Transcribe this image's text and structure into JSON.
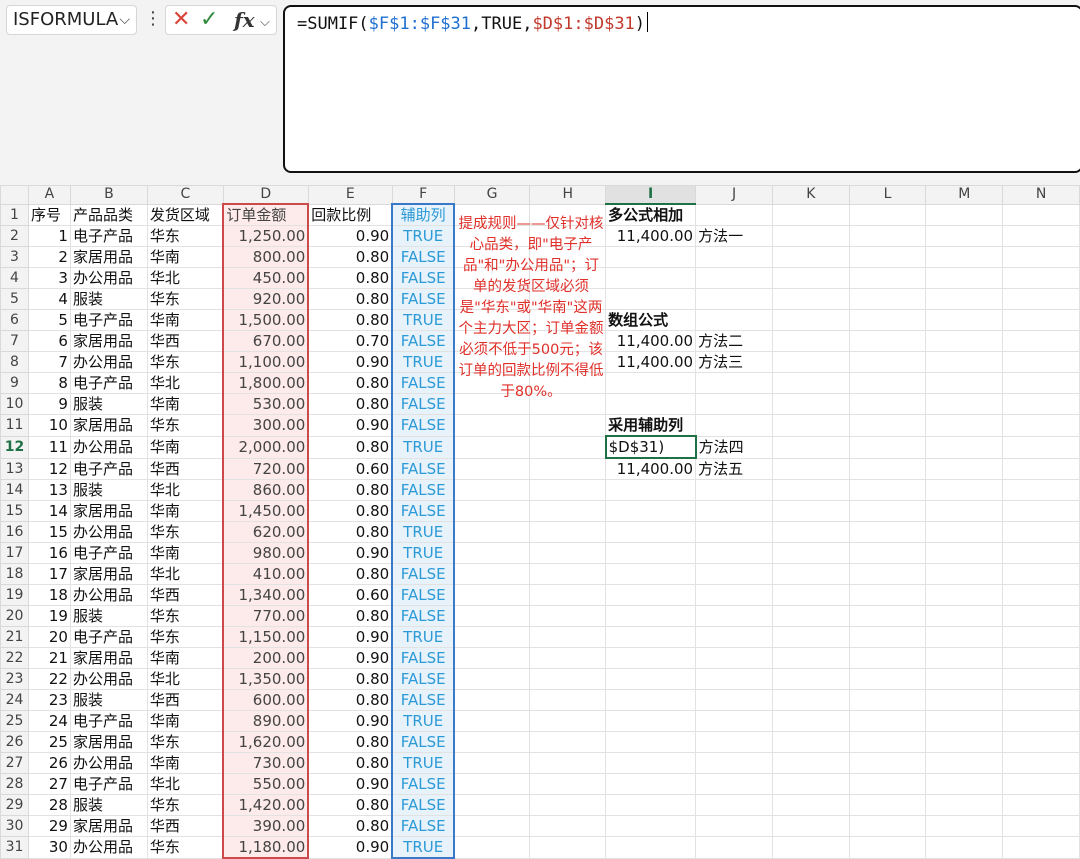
{
  "name_box": "ISFORMULA",
  "formula": {
    "prefix": "=SUMIF(",
    "range1": "$F$1:$F$31",
    "mid": ",TRUE,",
    "range2": "$D$1:$D$31",
    "suffix": ")"
  },
  "columns": [
    "A",
    "B",
    "C",
    "D",
    "E",
    "F",
    "G",
    "H",
    "I",
    "J",
    "K",
    "L",
    "M",
    "N"
  ],
  "headers": {
    "a": "序号",
    "b": "产品品类",
    "c": "发货区域",
    "d": "订单金额",
    "e": "回款比例",
    "f": "辅助列"
  },
  "rows": [
    [
      "1",
      "电子产品",
      "华东",
      "1,250.00",
      "0.90",
      "TRUE"
    ],
    [
      "2",
      "家居用品",
      "华南",
      "800.00",
      "0.80",
      "FALSE"
    ],
    [
      "3",
      "办公用品",
      "华北",
      "450.00",
      "0.80",
      "FALSE"
    ],
    [
      "4",
      "服装",
      "华东",
      "920.00",
      "0.80",
      "FALSE"
    ],
    [
      "5",
      "电子产品",
      "华南",
      "1,500.00",
      "0.80",
      "TRUE"
    ],
    [
      "6",
      "家居用品",
      "华西",
      "670.00",
      "0.70",
      "FALSE"
    ],
    [
      "7",
      "办公用品",
      "华东",
      "1,100.00",
      "0.90",
      "TRUE"
    ],
    [
      "8",
      "电子产品",
      "华北",
      "1,800.00",
      "0.80",
      "FALSE"
    ],
    [
      "9",
      "服装",
      "华南",
      "530.00",
      "0.80",
      "FALSE"
    ],
    [
      "10",
      "家居用品",
      "华东",
      "300.00",
      "0.90",
      "FALSE"
    ],
    [
      "11",
      "办公用品",
      "华南",
      "2,000.00",
      "0.80",
      "TRUE"
    ],
    [
      "12",
      "电子产品",
      "华西",
      "720.00",
      "0.60",
      "FALSE"
    ],
    [
      "13",
      "服装",
      "华北",
      "860.00",
      "0.80",
      "FALSE"
    ],
    [
      "14",
      "家居用品",
      "华南",
      "1,450.00",
      "0.80",
      "FALSE"
    ],
    [
      "15",
      "办公用品",
      "华东",
      "620.00",
      "0.80",
      "TRUE"
    ],
    [
      "16",
      "电子产品",
      "华南",
      "980.00",
      "0.90",
      "TRUE"
    ],
    [
      "17",
      "家居用品",
      "华北",
      "410.00",
      "0.80",
      "FALSE"
    ],
    [
      "18",
      "办公用品",
      "华西",
      "1,340.00",
      "0.60",
      "FALSE"
    ],
    [
      "19",
      "服装",
      "华东",
      "770.00",
      "0.80",
      "FALSE"
    ],
    [
      "20",
      "电子产品",
      "华东",
      "1,150.00",
      "0.90",
      "TRUE"
    ],
    [
      "21",
      "家居用品",
      "华南",
      "200.00",
      "0.90",
      "FALSE"
    ],
    [
      "22",
      "办公用品",
      "华北",
      "1,350.00",
      "0.80",
      "FALSE"
    ],
    [
      "23",
      "服装",
      "华西",
      "600.00",
      "0.80",
      "FALSE"
    ],
    [
      "24",
      "电子产品",
      "华南",
      "890.00",
      "0.90",
      "TRUE"
    ],
    [
      "25",
      "家居用品",
      "华东",
      "1,620.00",
      "0.80",
      "FALSE"
    ],
    [
      "26",
      "办公用品",
      "华南",
      "730.00",
      "0.80",
      "TRUE"
    ],
    [
      "27",
      "电子产品",
      "华北",
      "550.00",
      "0.90",
      "FALSE"
    ],
    [
      "28",
      "服装",
      "华东",
      "1,420.00",
      "0.80",
      "FALSE"
    ],
    [
      "29",
      "家居用品",
      "华西",
      "390.00",
      "0.80",
      "FALSE"
    ],
    [
      "30",
      "办公用品",
      "华东",
      "1,180.00",
      "0.90",
      "TRUE"
    ]
  ],
  "note": "提成规则——仅针对核心品类，即\"电子产品\"和\"办公用品\"；订单的发货区域必须是\"华东\"或\"华南\"这两个主力大区；订单金额必须不低于500元；该订单的回款比例不得低于80%。",
  "side": {
    "r1": [
      "多公式相加",
      ""
    ],
    "r2": [
      "11,400.00",
      "方法一"
    ],
    "r6": [
      "数组公式",
      ""
    ],
    "r7": [
      "11,400.00",
      "方法二"
    ],
    "r8": [
      "11,400.00",
      "方法三"
    ],
    "r11": [
      "采用辅助列",
      ""
    ],
    "r12": [
      "$D$31)",
      "方法四"
    ],
    "r13": [
      "11,400.00",
      "方法五"
    ]
  }
}
